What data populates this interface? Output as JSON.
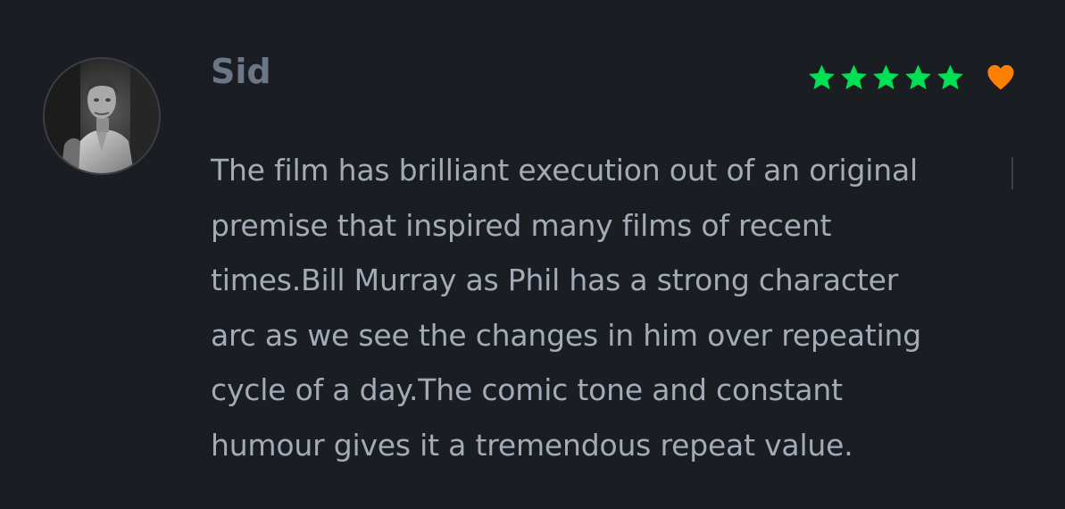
{
  "review": {
    "author": "Sid",
    "rating": {
      "stars": 5,
      "max": 5,
      "star_color": "#00e054",
      "liked": true,
      "heart_color": "#ff8000"
    },
    "text_lines": [
      "The film has brilliant execution out of an original",
      "premise that inspired many films of recent",
      "times.Bill Murray as Phil has a strong character",
      "arc as we see the changes in him over repeating",
      "cycle of a day.The comic tone and constant",
      "humour gives it a tremendous repeat value."
    ]
  },
  "colors": {
    "background": "#1a1d22",
    "author": "#6b7787",
    "body_text": "#a3abb7"
  },
  "icons": {
    "avatar": "avatar-photo",
    "star": "star-icon",
    "heart": "heart-icon"
  }
}
